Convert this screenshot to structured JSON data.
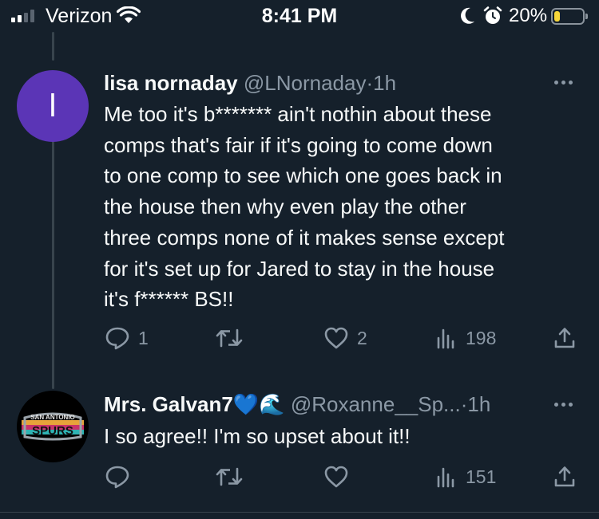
{
  "status_bar": {
    "carrier": "Verizon",
    "time": "8:41 PM",
    "battery_percent": "20%",
    "battery_level": 0.2,
    "battery_color": "#f7d63a"
  },
  "tweets": [
    {
      "avatar_letter": "l",
      "avatar_color": "#5b35b6",
      "name": "lisa nornaday",
      "handle": "@LNornaday",
      "separator": "·",
      "time": "1h",
      "lines": [
        "Me too it's b******* ain't nothin about these",
        "comps that's fair if it's going to come down",
        "to one comp to see which one goes back in",
        "the house then why even play the other",
        "three comps none of it makes sense except",
        "for it's set up for Jared to stay in the house",
        "it's f****** BS!!"
      ],
      "replies": "1",
      "retweets": "",
      "likes": "2",
      "views": "198"
    },
    {
      "avatar_icon": "san-antonio-spurs-logo",
      "avatar_logo_text": [
        "SAN ANTONIO",
        "SPURS"
      ],
      "name": "Mrs. Galvan7",
      "name_emoji": "💙🌊",
      "handle": "@Roxanne__Sp...",
      "separator": "·",
      "time": "1h",
      "lines": [
        "I so agree!! I'm so upset about it!!"
      ],
      "replies": "",
      "retweets": "",
      "likes": "",
      "views": "151"
    }
  ],
  "colors": {
    "background": "#15202b",
    "text": "#f7f9f9",
    "secondary": "#8b98a5",
    "thread_line": "#38444d"
  }
}
